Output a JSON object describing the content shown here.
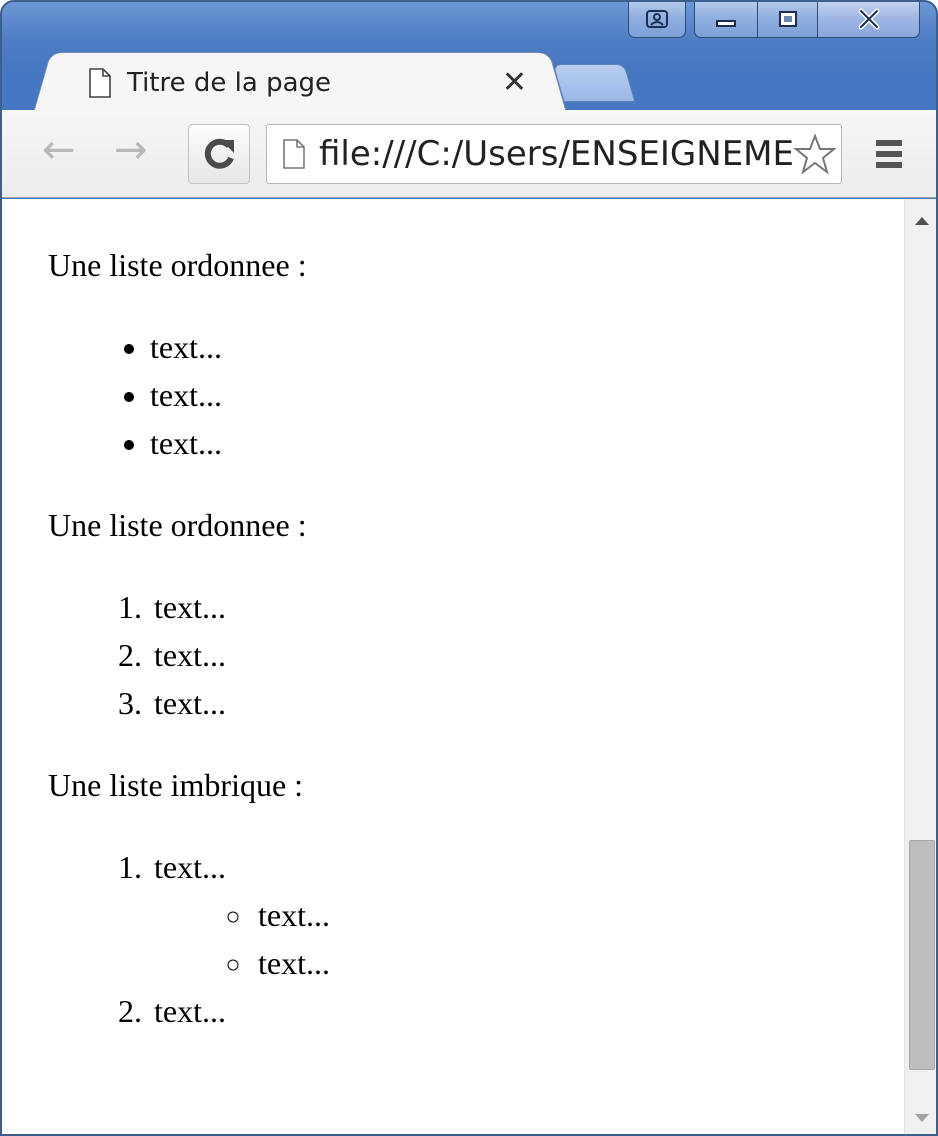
{
  "window": {
    "tab_title": "Titre de la page",
    "tab_close": "✕",
    "caption_buttons": [
      "user-icon",
      "minimize-icon",
      "maximize-icon",
      "close-icon"
    ]
  },
  "toolbar": {
    "back_icon": "←",
    "forward_icon": "→",
    "url": "file:///C:/Users/ENSEIGNEMENT"
  },
  "page": {
    "heading1": "Une liste ordonnee :",
    "list1": [
      "text...",
      "text...",
      "text..."
    ],
    "heading2": "Une liste ordonnee :",
    "list2": [
      "text...",
      "text...",
      "text..."
    ],
    "heading3": "Une liste imbrique :",
    "list3": [
      {
        "label": "text...",
        "children": [
          "text...",
          "text..."
        ]
      },
      {
        "label": "text..."
      }
    ]
  },
  "scroll": {
    "thumb_position": 0.95
  }
}
